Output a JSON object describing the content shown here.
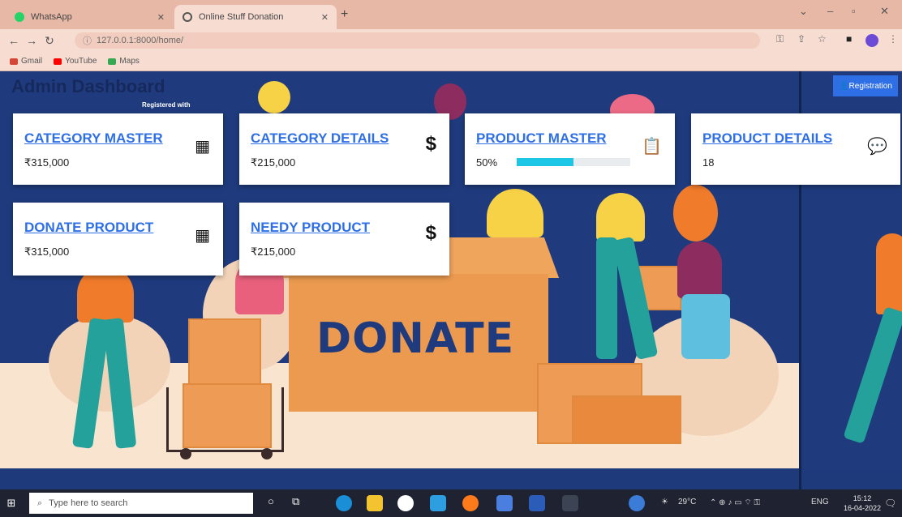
{
  "browser": {
    "tabs": [
      {
        "title": "WhatsApp",
        "active": false,
        "favicon_color": "#25d366"
      },
      {
        "title": "Online Stuff Donation",
        "active": true,
        "favicon_color": "#555555"
      }
    ],
    "new_tab_label": "+",
    "url": "127.0.0.1:8000/home/",
    "bookmarks": [
      {
        "label": "Gmail",
        "icon_color": "#d44638"
      },
      {
        "label": "YouTube",
        "icon_color": "#ff0000"
      },
      {
        "label": "Maps",
        "icon_color": "#34a853"
      }
    ]
  },
  "page": {
    "title": "Admin Dashboard",
    "registration_button": "Registration",
    "registered_text": "Registered with",
    "hero_word": "DONATE"
  },
  "cards": [
    {
      "title": "CATEGORY MASTER",
      "value": "₹315,000",
      "icon": "calendar-icon"
    },
    {
      "title": "CATEGORY DETAILS",
      "value": "₹215,000",
      "icon": "dollar-icon"
    },
    {
      "title": "PRODUCT MASTER",
      "value": "50%",
      "icon": "clipboard-icon",
      "progress": 0.5
    },
    {
      "title": "PRODUCT DETAILS",
      "value": "18",
      "icon": "comments-icon"
    },
    {
      "title": "DONATE PRODUCT",
      "value": "₹315,000",
      "icon": "calendar-icon"
    },
    {
      "title": "NEEDY PRODUCT",
      "value": "₹215,000",
      "icon": "dollar-icon"
    }
  ],
  "taskbar": {
    "search_placeholder": "Type here to search",
    "weather": "29°C",
    "language": "ENG",
    "time": "15:12",
    "date": "16-04-2022"
  },
  "colors": {
    "accent": "#2f6fe6",
    "hero_background": "#1f3b7d",
    "progress": "#1ec6e6"
  }
}
